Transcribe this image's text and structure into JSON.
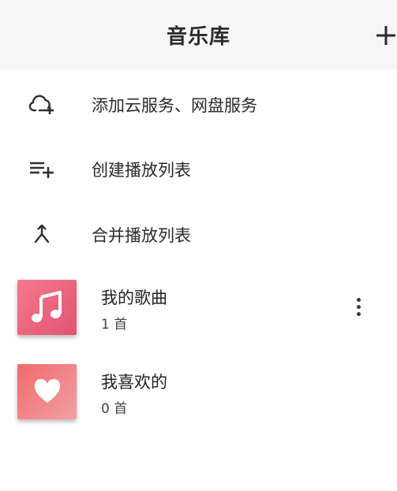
{
  "header": {
    "title": "音乐库"
  },
  "actions": [
    {
      "label": "添加云服务、网盘服务",
      "icon": "cloud-add-icon"
    },
    {
      "label": "创建播放列表",
      "icon": "playlist-add-icon"
    },
    {
      "label": "合并播放列表",
      "icon": "merge-icon"
    }
  ],
  "playlists": [
    {
      "name": "我的歌曲",
      "count": "1 首",
      "icon": "music-note-icon",
      "cover_colors": [
        "#f47a8e",
        "#e2546f"
      ]
    },
    {
      "name": "我喜欢的",
      "count": "0 首",
      "icon": "heart-icon",
      "cover_colors": [
        "#f26a6a",
        "#f0a0a6"
      ]
    }
  ],
  "colors": {
    "header_bg": "#f6f6f6",
    "text": "#222222"
  }
}
